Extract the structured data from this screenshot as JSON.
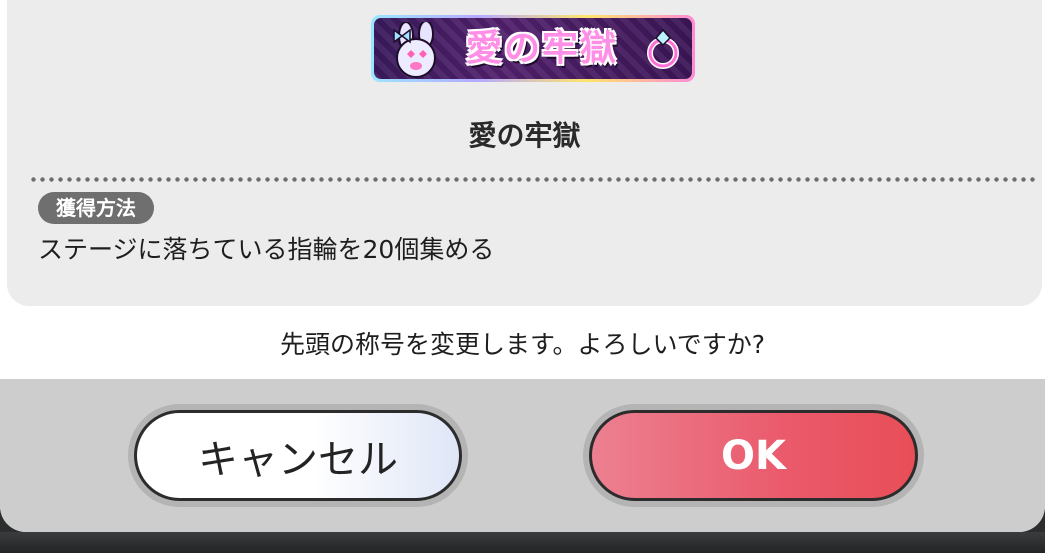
{
  "badge": {
    "text": "愛の牢獄"
  },
  "title": {
    "name": "愛の牢獄"
  },
  "acquisition": {
    "tag_label": "獲得方法",
    "description": "ステージに落ちている指輪を20個集める"
  },
  "confirm": {
    "question": "先頭の称号を変更します。よろしいですか?"
  },
  "buttons": {
    "cancel_label": "キャンセル",
    "ok_label": "OK"
  },
  "icons": [
    "bunny-icon",
    "ring-icon"
  ],
  "colors": {
    "ok": "#ea5a6c",
    "cancel": "#ffffff",
    "tag": "#6f6f6f",
    "panel": "#ececec",
    "footer": "#cdcdcd"
  }
}
